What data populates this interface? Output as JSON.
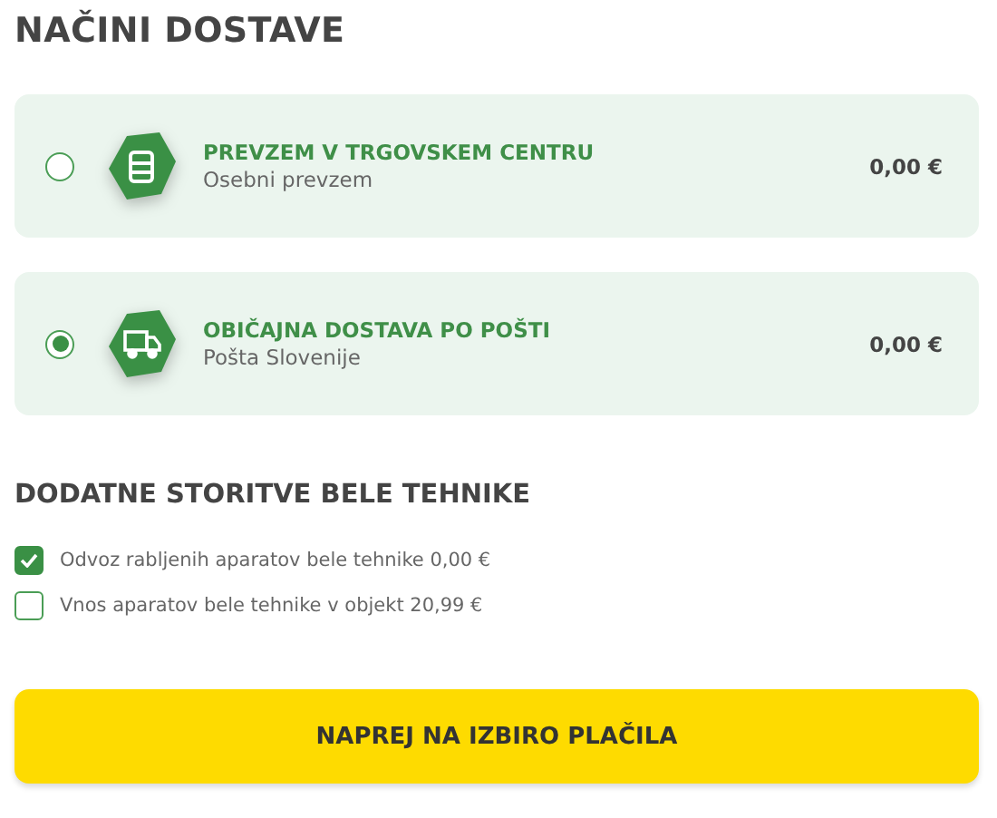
{
  "title": "NAČINI DOSTAVE",
  "options": [
    {
      "kind": "store",
      "name": "PREVZEM V TRGOVSKEM CENTRU",
      "subtitle": "Osebni prevzem",
      "price": "0,00 €",
      "selected": false
    },
    {
      "kind": "truck",
      "name": "OBIČAJNA DOSTAVA PO POŠTI",
      "subtitle": "Pošta Slovenije",
      "price": "0,00 €",
      "selected": true
    }
  ],
  "services_title": "DODATNE STORITVE BELE TEHNIKE",
  "services": [
    {
      "label": "Odvoz rabljenih aparatov bele tehnike 0,00 €",
      "checked": true
    },
    {
      "label": "Vnos aparatov bele tehnike v objekt 20,99 €",
      "checked": false
    }
  ],
  "submit": "NAPREJ NA IZBIRO PLAČILA"
}
